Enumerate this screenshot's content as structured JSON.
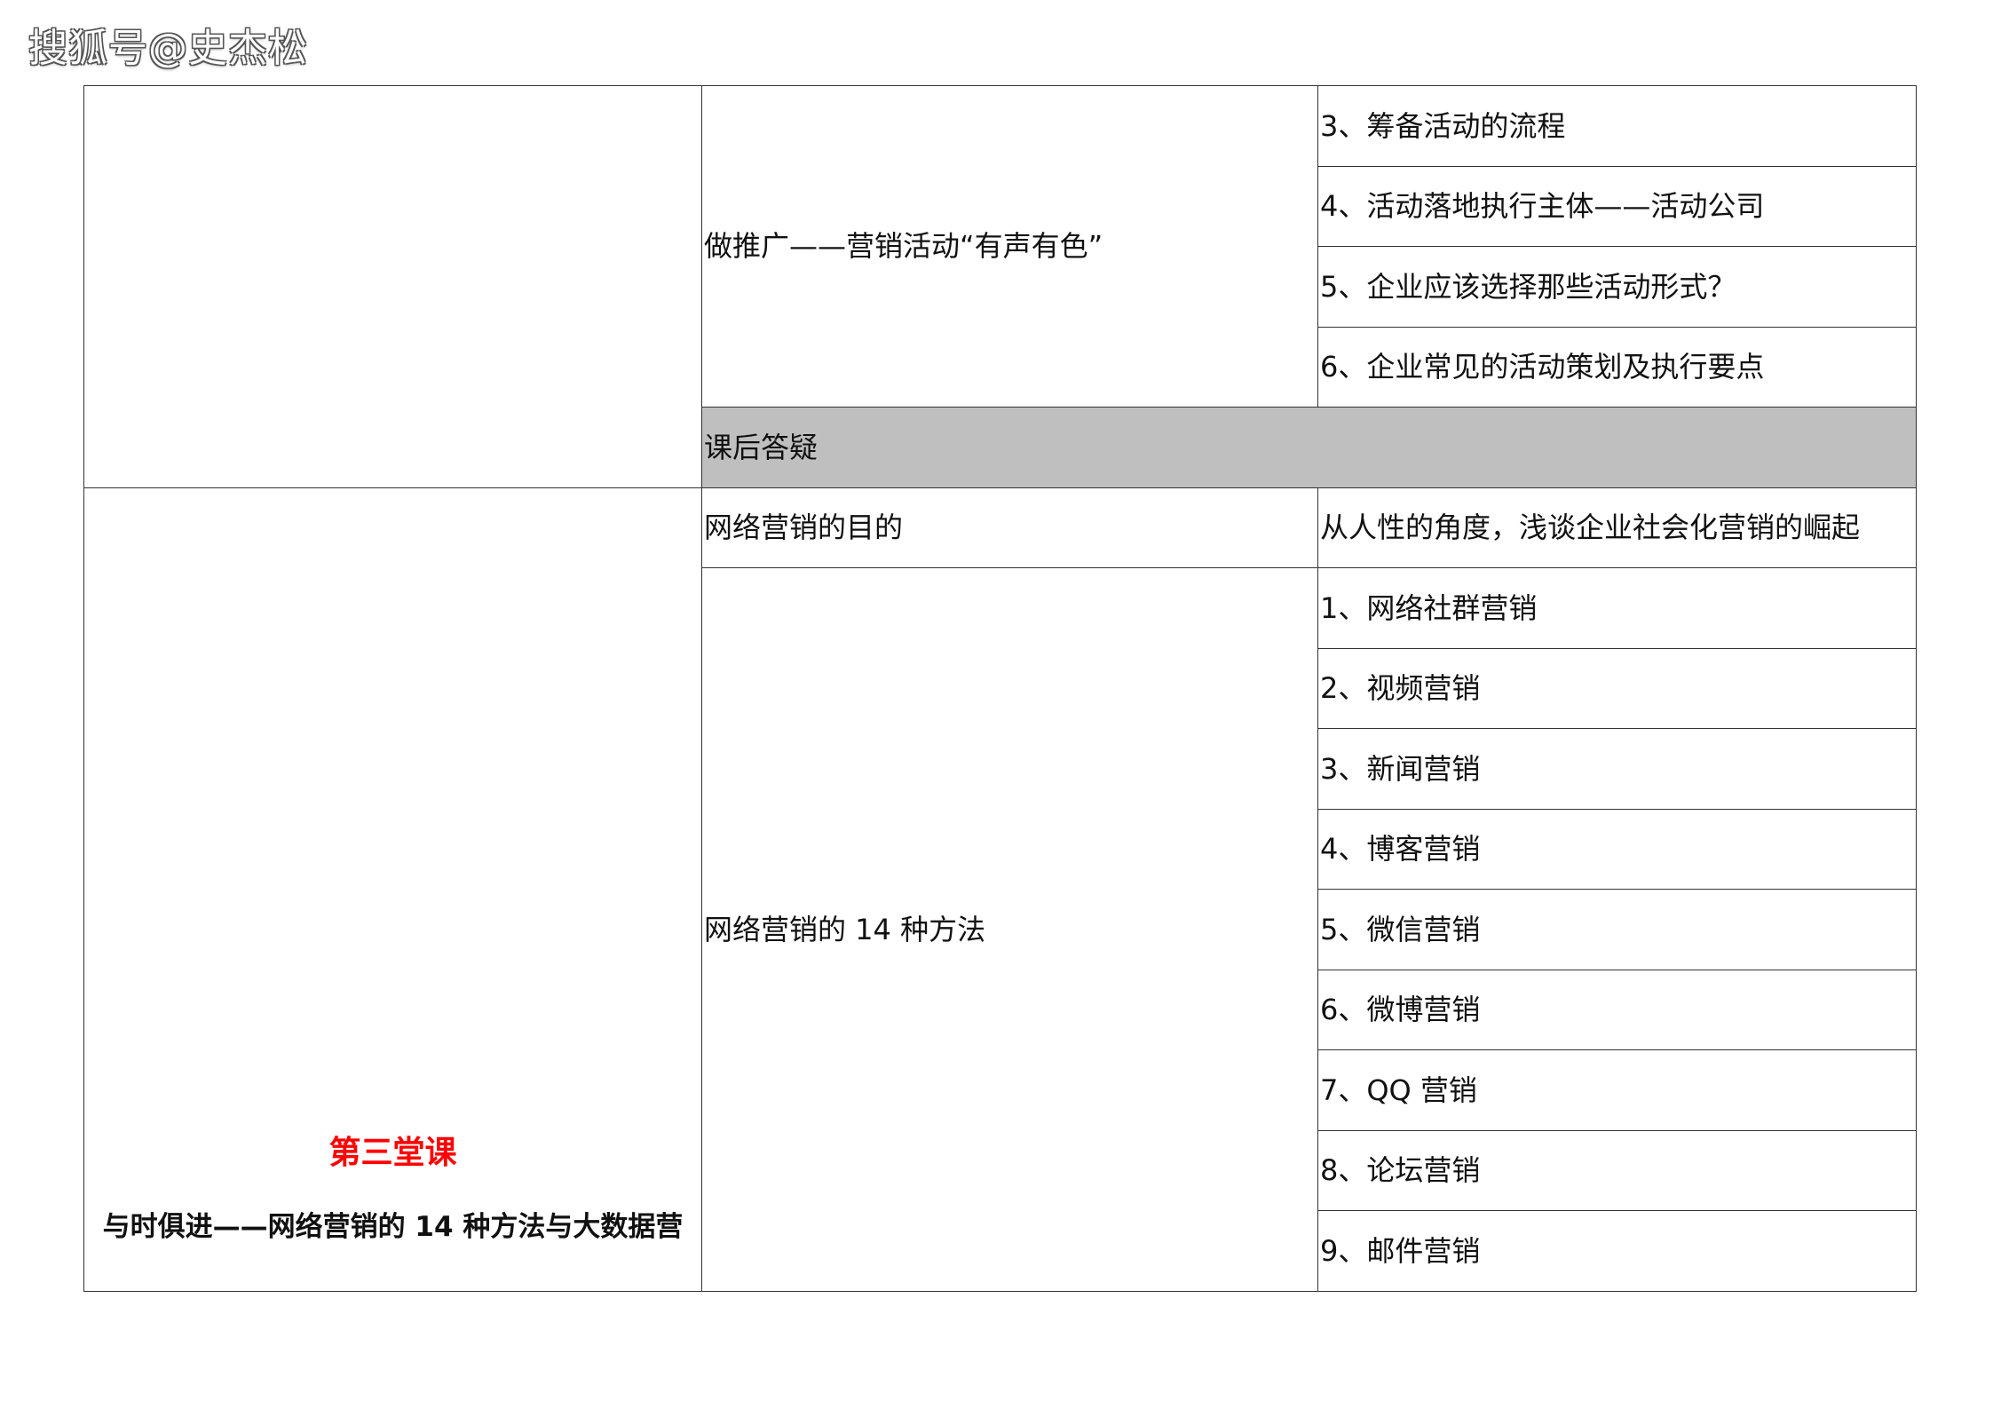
{
  "watermark": "搜狐号@史杰松",
  "section_top": {
    "topic": "做推广——营销活动“有声有色”",
    "items": [
      "3、筹备活动的流程",
      "4、活动落地执行主体——活动公司",
      "5、企业应该选择那些活动形式？",
      "6、企业常见的活动策划及执行要点"
    ],
    "qa_label": "课后答疑"
  },
  "lesson3": {
    "number_label": "第三堂课",
    "title": "与时俱进——网络营销的 14 种方法与大数据营",
    "purpose": {
      "topic": "网络营销的目的",
      "detail": "从人性的角度，浅谈企业社会化营销的崛起"
    },
    "methods": {
      "topic": "网络营销的 14 种方法",
      "items": [
        "1、网络社群营销",
        "2、视频营销",
        "3、新闻营销",
        "4、博客营销",
        "5、微信营销",
        "6、微博营销",
        "7、QQ 营销",
        "8、论坛营销",
        "9、邮件营销"
      ]
    }
  },
  "colors": {
    "qa_background": "#bfbfbf",
    "lesson_number": "#ff0000",
    "border": "#333333"
  }
}
